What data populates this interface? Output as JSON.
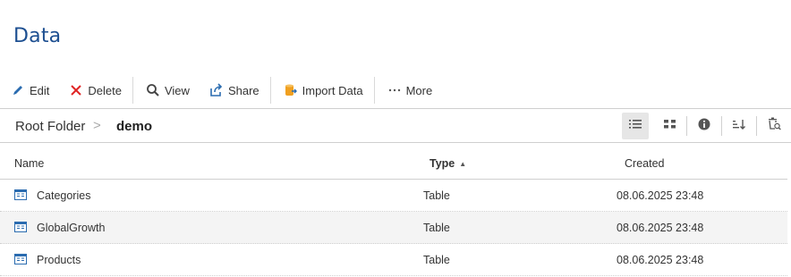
{
  "page": {
    "title": "Data"
  },
  "toolbar": {
    "edit": "Edit",
    "delete": "Delete",
    "view": "View",
    "share": "Share",
    "import": "Import Data",
    "more": "More"
  },
  "breadcrumb": {
    "root": "Root Folder",
    "separator": ">",
    "current": "demo"
  },
  "view_tools": [
    "list-view-icon",
    "grid-view-icon",
    "info-icon",
    "sort-icon",
    "recycle-bin-search-icon"
  ],
  "table": {
    "headers": {
      "name": "Name",
      "type": "Type",
      "type_sort": "▲",
      "created": "Created"
    },
    "rows": [
      {
        "name": "Categories",
        "type": "Table",
        "created": "08.06.2025 23:48"
      },
      {
        "name": "GlobalGrowth",
        "type": "Table",
        "created": "08.06.2025 23:48"
      },
      {
        "name": "Products",
        "type": "Table",
        "created": "08.06.2025 23:48"
      }
    ]
  },
  "colors": {
    "title": "#1d4f91",
    "accent": "#2b6cb0",
    "delete": "#e02424",
    "import": "#f0a020"
  }
}
